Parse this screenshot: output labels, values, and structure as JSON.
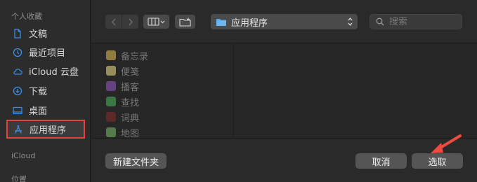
{
  "sidebar": {
    "favorites_header": "个人收藏",
    "items": [
      {
        "label": "文稿",
        "icon": "document-icon"
      },
      {
        "label": "最近项目",
        "icon": "clock-icon"
      },
      {
        "label": "iCloud 云盘",
        "icon": "cloud-icon"
      },
      {
        "label": "下载",
        "icon": "download-icon"
      },
      {
        "label": "桌面",
        "icon": "desktop-icon"
      },
      {
        "label": "应用程序",
        "icon": "app-store-icon",
        "selected": true
      }
    ],
    "icloud_header": "iCloud",
    "locations_header": "位置"
  },
  "toolbar": {
    "location": "应用程序",
    "search_placeholder": "搜索"
  },
  "files": [
    {
      "name": "备忘录",
      "color": "#e8c25a"
    },
    {
      "name": "便笺",
      "color": "#f2e38a"
    },
    {
      "name": "播客",
      "color": "#9b59d0"
    },
    {
      "name": "查找",
      "color": "#4cba5a"
    },
    {
      "name": "词典",
      "color": "#8b2a2a"
    },
    {
      "name": "地图",
      "color": "#7bbf6a"
    }
  ],
  "buttons": {
    "new_folder": "新建文件夹",
    "cancel": "取消",
    "choose": "选取"
  },
  "colors": {
    "selection_outline": "#e0443c",
    "annotation_arrow": "#ef4a3f"
  }
}
